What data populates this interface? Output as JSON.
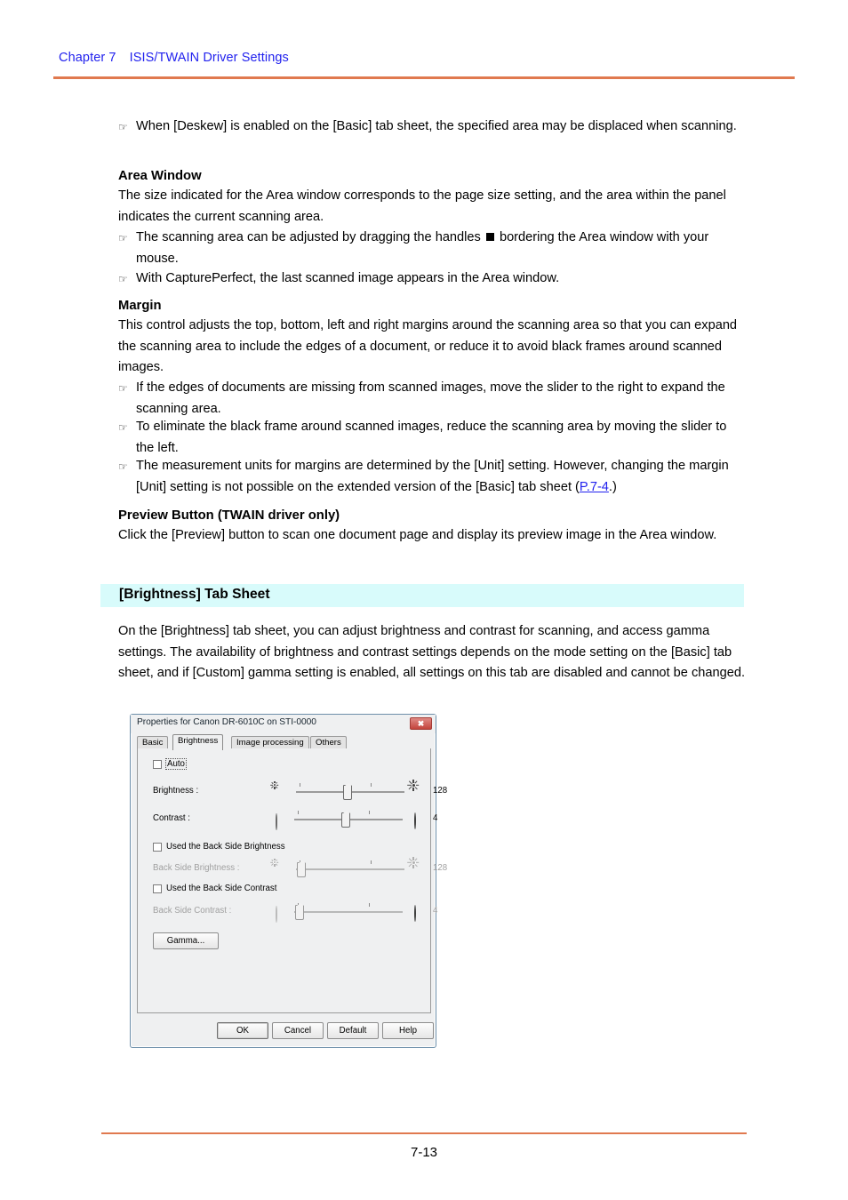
{
  "header": {
    "chapter": "Chapter 7",
    "title": "ISIS/TWAIN Driver Settings"
  },
  "body": {
    "bullet_deskew": "When [Deskew] is enabled on the [Basic] tab sheet, the specified area may be displaced when scanning.",
    "area_window_heading": "Area Window",
    "area_window_para": "The size indicated for the Area window corresponds to the page size setting, and the area within the panel indicates the current scanning area.",
    "area_bullet_1_pre": "The scanning area can be adjusted by dragging the handles",
    "area_bullet_1_post": "bordering the Area window with your mouse.",
    "area_bullet_2": "With CapturePerfect, the last scanned image appears in the Area window.",
    "margin_heading": "Margin",
    "margin_para": "This control adjusts the top, bottom, left and right margins around the scanning area so that you can expand the scanning area to include the edges of a document, or reduce it to avoid black frames around scanned images.",
    "margin_bullet_1": "If the edges of documents are missing from scanned images, move the slider to the right to expand the scanning area.",
    "margin_bullet_2": "To eliminate the black frame around scanned images, reduce the scanning area by moving the slider to the left.",
    "margin_bullet_3_pre": "The measurement units for margins are determined by the [Unit] setting. However, changing the margin [Unit] setting is not possible on the extended version of the [Basic] tab sheet (",
    "margin_bullet_3_link": "P.7-4",
    "margin_bullet_3_post": ".)",
    "preview_heading": "Preview Button (TWAIN driver only)",
    "preview_para": "Click the [Preview] button to scan one document page and display its preview image in the Area window."
  },
  "section": {
    "title": "[Brightness] Tab Sheet",
    "intro": "On the [Brightness] tab sheet, you can adjust brightness and contrast for scanning, and access gamma settings. The availability of brightness and contrast settings depends on the mode setting on the [Basic] tab sheet, and if [Custom] gamma setting is enabled, all settings on this tab are disabled and cannot be changed."
  },
  "dialog": {
    "title": "Properties for Canon DR-6010C on  STI-0000",
    "close_label": "✖",
    "tabs": [
      {
        "label": "Basic",
        "active": false
      },
      {
        "label": "Brightness",
        "active": true
      },
      {
        "label": "Image processing",
        "active": false
      },
      {
        "label": "Others",
        "active": false
      }
    ],
    "auto_checkbox": {
      "label": "Auto",
      "checked": false
    },
    "brightness": {
      "label": "Brightness :",
      "value": "128",
      "enabled": true,
      "thumb_pct": 50
    },
    "contrast": {
      "label": "Contrast :",
      "value": "4",
      "enabled": true,
      "thumb_pct": 50
    },
    "use_back_side_brightness": {
      "label": "Used the Back Side Brightness",
      "checked": false
    },
    "back_side_brightness": {
      "label": "Back Side Brightness :",
      "value": "128",
      "enabled": false,
      "thumb_pct": 2
    },
    "use_back_side_contrast": {
      "label": "Used the Back Side Contrast",
      "checked": false
    },
    "back_side_contrast": {
      "label": "Back Side Contrast :",
      "value": "4",
      "enabled": false,
      "thumb_pct": 2
    },
    "gamma_button": "Gamma...",
    "footer_buttons": [
      {
        "label": "OK",
        "default": true
      },
      {
        "label": "Cancel",
        "default": false
      },
      {
        "label": "Default",
        "default": false
      },
      {
        "label": "Help",
        "default": false
      }
    ]
  },
  "footer": {
    "page_number": "7-13"
  },
  "colors": {
    "header_link": "#2222ee",
    "rule": "#e0794f",
    "section_band": "#d8fbfb",
    "close_button": "#c3443c"
  }
}
